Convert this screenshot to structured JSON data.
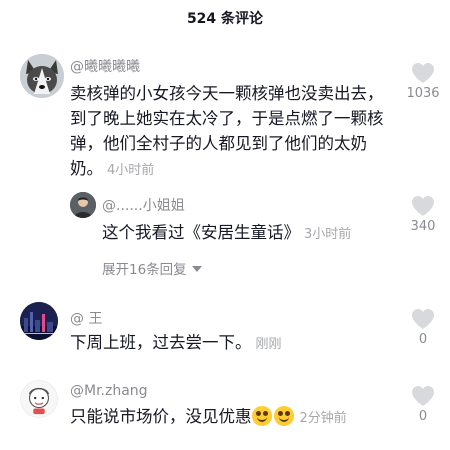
{
  "header": {
    "title": "524 条评论"
  },
  "comments": [
    {
      "username": "@曦曦曦曦",
      "text": "卖核弹的小女孩今天一颗核弹也没卖出去，到了晚上她实在太冷了，于是点燃了一颗核弹，他们全村子的人都见到了他们的太奶奶。",
      "time": "4小时前",
      "likes": "1036",
      "avatar_icon": "husky-dog-avatar"
    },
    {
      "username": "@......小姐姐",
      "text": "这个我看过《安居生童话》",
      "time": "3小时前",
      "likes": "340",
      "avatar_icon": "person-avatar"
    },
    {
      "username": "@ 王",
      "text": "下周上班，过去尝一下。",
      "time": "刚刚",
      "likes": "0",
      "avatar_icon": "city-night-avatar"
    },
    {
      "username": "@Mr.zhang",
      "text": "只能说市场价，没见优惠",
      "time": "2分钟前",
      "likes": "0",
      "avatar_icon": "cartoon-avatar"
    }
  ],
  "expand_replies": "展开16条回复",
  "colors": {
    "text": "#161823",
    "secondary": "#8a8b91",
    "muted": "#a7a8ac",
    "heart": "#d8d9dc"
  }
}
